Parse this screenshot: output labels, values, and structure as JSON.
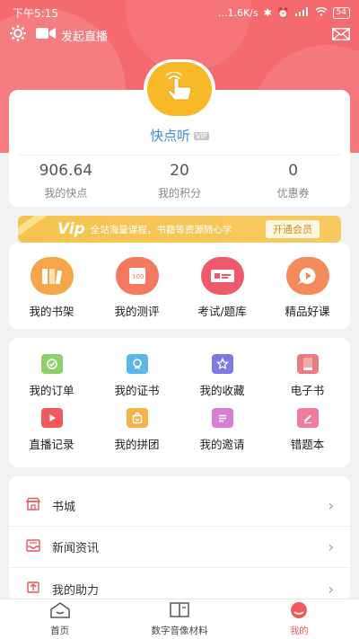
{
  "status_bar": {
    "time": "下午5:15",
    "network_speed": "...1.6K/s",
    "battery": "54"
  },
  "header": {
    "live_label": "发起直播"
  },
  "profile": {
    "username": "快点听",
    "vip_badge": "VIP",
    "stats": [
      {
        "value": "906.64",
        "label": "我的快点"
      },
      {
        "value": "20",
        "label": "我的积分"
      },
      {
        "value": "0",
        "label": "优惠券"
      }
    ]
  },
  "vip_banner": {
    "title": "Vip",
    "description": "全站海量课程，书籍等资源随心学",
    "button": "开通会员"
  },
  "main_features": [
    {
      "label": "我的书架"
    },
    {
      "label": "我的测评"
    },
    {
      "label": "考试/题库"
    },
    {
      "label": "精品好课"
    }
  ],
  "features": [
    {
      "label": "我的订单"
    },
    {
      "label": "我的证书"
    },
    {
      "label": "我的收藏"
    },
    {
      "label": "电子书"
    },
    {
      "label": "直播记录"
    },
    {
      "label": "我的拼团"
    },
    {
      "label": "我的邀请"
    },
    {
      "label": "错题本"
    }
  ],
  "menu": [
    {
      "label": "书城"
    },
    {
      "label": "新闻资讯"
    },
    {
      "label": "我的助力"
    }
  ],
  "bottom_nav": [
    {
      "label": "首页"
    },
    {
      "label": "数字音像材料"
    },
    {
      "label": "我的"
    }
  ],
  "colors": {
    "brand": "#f46a6e",
    "active": "#f25b5e",
    "link": "#3a8ee6",
    "vip": "#f6c34f"
  }
}
